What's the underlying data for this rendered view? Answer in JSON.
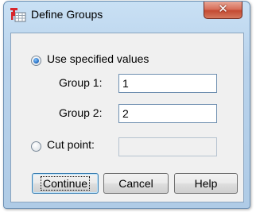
{
  "window": {
    "title": "Define Groups",
    "close_glyph": "✕",
    "app_icon": "spss-table-icon"
  },
  "options": {
    "use_specified_values": {
      "label": "Use specified values",
      "checked": true
    },
    "cut_point": {
      "label": "Cut point:",
      "checked": false,
      "value": ""
    }
  },
  "groups": {
    "group1": {
      "label": "Group 1:",
      "value": "1"
    },
    "group2": {
      "label": "Group 2:",
      "value": "2"
    }
  },
  "buttons": {
    "continue": "Continue",
    "cancel": "Cancel",
    "help": "Help"
  },
  "colors": {
    "title_bar": "#b9d3ec",
    "close_button": "#c44a32",
    "dialog_body": "#f0f0f0",
    "radio_selected": "#2a73c6"
  }
}
